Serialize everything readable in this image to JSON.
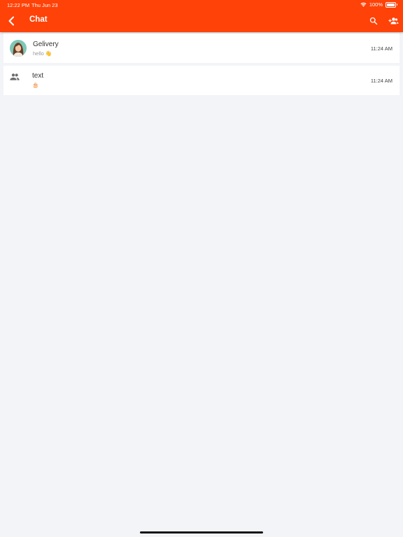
{
  "status_bar": {
    "time": "12:22 PM",
    "date": "Thu Jun 23",
    "battery": "100%"
  },
  "header": {
    "title": "Chat",
    "accent_color": "#ff4208"
  },
  "chats": [
    {
      "name": "Gelivery",
      "preview": "hello 👋",
      "time": "11:24 AM",
      "type": "direct"
    },
    {
      "name": "text",
      "preview": "🎂",
      "time": "11:24 AM",
      "type": "group"
    }
  ]
}
